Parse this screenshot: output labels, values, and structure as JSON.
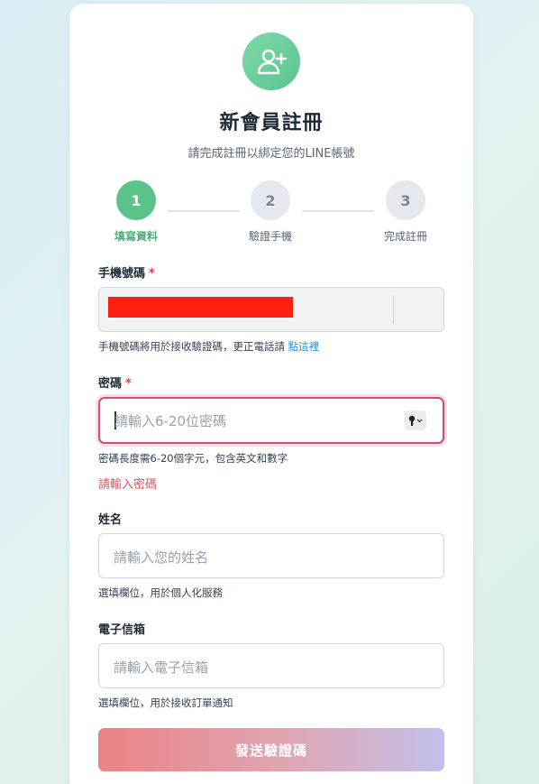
{
  "header": {
    "title": "新會員註冊",
    "subtitle": "請完成註冊以綁定您的LINE帳號"
  },
  "steps": [
    {
      "number": "1",
      "label": "填寫資料",
      "state": "active"
    },
    {
      "number": "2",
      "label": "驗證手機",
      "state": "inactive"
    },
    {
      "number": "3",
      "label": "完成註冊",
      "state": "inactive"
    }
  ],
  "phone": {
    "label": "手機號碼",
    "required_mark": "*",
    "value": "",
    "hint": "手機號碼將用於接收驗證碼，更正電話請",
    "hint_link": "點這裡"
  },
  "password": {
    "label": "密碼",
    "required_mark": "*",
    "placeholder": "請輸入6-20位密碼",
    "hint": "密碼長度需6-20個字元，包含英文和數字",
    "error": "請輸入密碼",
    "key_icon": "key-icon"
  },
  "name": {
    "label": "姓名",
    "placeholder": "請輸入您的姓名",
    "hint": "選填欄位，用於個人化服務"
  },
  "email": {
    "label": "電子信箱",
    "placeholder": "請輸入電子信箱",
    "hint": "選填欄位，用於接收訂單通知"
  },
  "submit": {
    "label": "發送驗證碼"
  },
  "colors": {
    "accent_green": "#5bc389",
    "error_red": "#e05560",
    "link_blue": "#2b8bd6",
    "focus_border": "#d14b7d"
  }
}
